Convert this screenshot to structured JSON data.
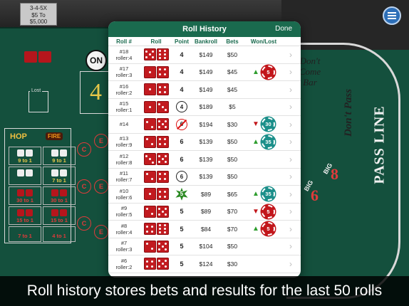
{
  "table": {
    "odds_box_lines": [
      "3-4-5X",
      "$5 To",
      "$5,000"
    ],
    "on_puck": "ON",
    "point_number": "4",
    "lost_label": "Lost",
    "hop": "HOP",
    "fire": "FIRE",
    "props": [
      {
        "label": "9 to 1",
        "red": false
      },
      {
        "label": "9 to 1",
        "red": false
      },
      {
        "label": "",
        "red": false
      },
      {
        "label": "7 to 1",
        "red": false
      },
      {
        "label": "30 to 1",
        "red": true
      },
      {
        "label": "30 to 1",
        "red": true
      },
      {
        "label": "15 to 1",
        "red": true
      },
      {
        "label": "15 to 1",
        "red": true
      },
      {
        "label": "7 to 1",
        "red": true
      },
      {
        "label": "4 to 1",
        "red": true
      }
    ],
    "ce_letters": [
      "C",
      "E",
      "C",
      "E",
      "C",
      "E"
    ],
    "dont_come_lines": [
      "Don't",
      "Come",
      "Bar"
    ],
    "dont_pass": "Don't Pass",
    "pass_line": "PASS LINE",
    "big_label": "BIG",
    "big6": "6",
    "big8": "8"
  },
  "popup": {
    "title": "Roll History",
    "done": "Done",
    "columns": {
      "roll_num": "Roll #",
      "roll": "Roll",
      "point": "Point",
      "bankroll": "Bankroll",
      "bets": "Bets",
      "won_lost": "Won/Lost"
    },
    "rows": [
      {
        "id": "#18",
        "roller": "roller:4",
        "dice": [
          5,
          6
        ],
        "point": "4",
        "point_style": "plain",
        "bankroll": "$149",
        "bets": "$50",
        "result": null
      },
      {
        "id": "#17",
        "roller": "roller:3",
        "dice": [
          1,
          4
        ],
        "point": "4",
        "point_style": "plain",
        "bankroll": "$149",
        "bets": "$45",
        "result": {
          "dir": "up",
          "amount": "5",
          "chip": "red"
        }
      },
      {
        "id": "#16",
        "roller": "roller:2",
        "dice": [
          1,
          4
        ],
        "point": "4",
        "point_style": "plain",
        "bankroll": "$149",
        "bets": "$45",
        "result": null
      },
      {
        "id": "#15",
        "roller": "roller:1",
        "dice": [
          1,
          3
        ],
        "point": "4",
        "point_style": "circle",
        "bankroll": "$189",
        "bets": "$5",
        "result": null
      },
      {
        "id": "#14",
        "roller": "",
        "dice": [
          2,
          5
        ],
        "point": "6",
        "point_style": "no",
        "bankroll": "$194",
        "bets": "$30",
        "result": {
          "dir": "down",
          "amount": "30",
          "chip": "teal"
        }
      },
      {
        "id": "#13",
        "roller": "roller:9",
        "dice": [
          2,
          4
        ],
        "point": "6",
        "point_style": "plain",
        "bankroll": "$139",
        "bets": "$50",
        "result": {
          "dir": "up",
          "amount": "35",
          "chip": "teal"
        }
      },
      {
        "id": "#12",
        "roller": "roller:8",
        "dice": [
          3,
          5
        ],
        "point": "6",
        "point_style": "plain",
        "bankroll": "$139",
        "bets": "$50",
        "result": null
      },
      {
        "id": "#11",
        "roller": "roller:7",
        "dice": [
          2,
          4
        ],
        "point": "6",
        "point_style": "circle",
        "bankroll": "$139",
        "bets": "$50",
        "result": null
      },
      {
        "id": "#10",
        "roller": "roller:6",
        "dice": [
          1,
          4
        ],
        "point": "5",
        "point_style": "star",
        "bankroll": "$89",
        "bets": "$65",
        "result": {
          "dir": "up",
          "amount": "35",
          "chip": "teal"
        }
      },
      {
        "id": "#9",
        "roller": "roller:5",
        "dice": [
          2,
          5
        ],
        "point": "5",
        "point_style": "plain",
        "bankroll": "$89",
        "bets": "$70",
        "result": {
          "dir": "down",
          "amount": "5",
          "chip": "red"
        }
      },
      {
        "id": "#8",
        "roller": "roller:4",
        "dice": [
          4,
          6
        ],
        "point": "5",
        "point_style": "plain",
        "bankroll": "$84",
        "bets": "$70",
        "result": {
          "dir": "up",
          "amount": "5",
          "chip": "red"
        }
      },
      {
        "id": "#7",
        "roller": "roller:3",
        "dice": [
          2,
          5
        ],
        "point": "5",
        "point_style": "plain",
        "bankroll": "$104",
        "bets": "$50",
        "result": null
      },
      {
        "id": "#6",
        "roller": "roller:2",
        "dice": [
          4,
          5
        ],
        "point": "5",
        "point_style": "plain",
        "bankroll": "$124",
        "bets": "$30",
        "result": null
      }
    ]
  },
  "caption": "Roll history stores bets and results for the last 50 rolls",
  "colors": {
    "header_green": "#1a6a4e",
    "felt": "#14503d",
    "die_red": "#c21a1f",
    "chip_red": "#c2161b",
    "chip_teal": "#1b8f8a"
  }
}
